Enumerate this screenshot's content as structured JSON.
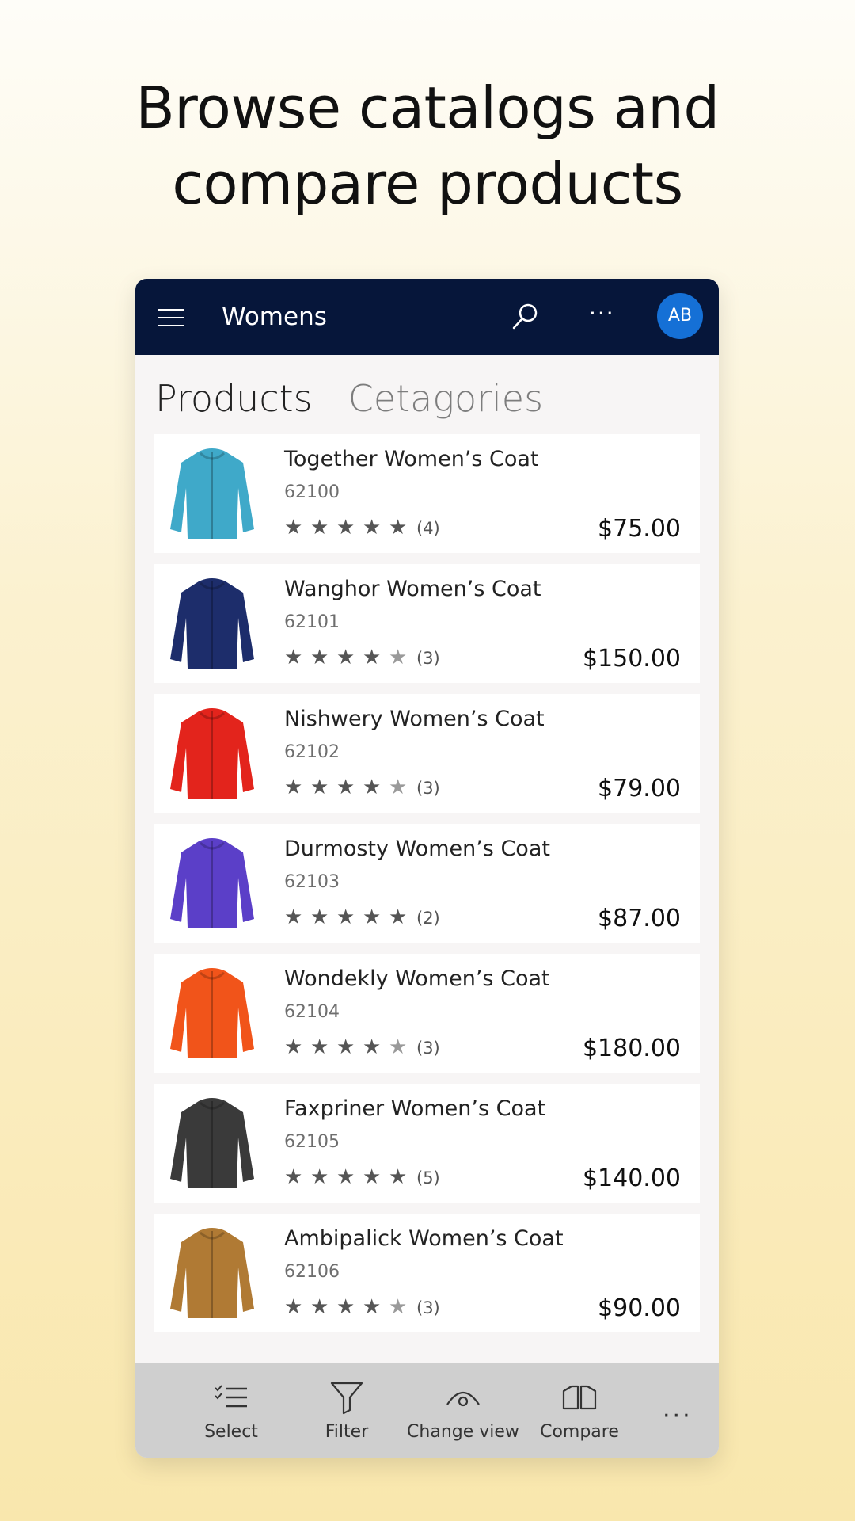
{
  "headline": {
    "line1": "Browse catalogs and",
    "line2": "compare products"
  },
  "appbar": {
    "title": "Womens",
    "avatar_initials": "AB"
  },
  "tabs": [
    {
      "label": "Products"
    },
    {
      "label": "Cetagories"
    }
  ],
  "products": [
    {
      "name": "Together Women’s Coat",
      "sku": "62100",
      "rating": 5,
      "reviews": "(4)",
      "price": "$75.00",
      "color": "#3fa9c9"
    },
    {
      "name": "Wanghor Women’s Coat",
      "sku": "62101",
      "rating": 4,
      "reviews": "(3)",
      "price": "$150.00",
      "color": "#1d2d6b"
    },
    {
      "name": "Nishwery Women’s Coat",
      "sku": "62102",
      "rating": 4,
      "reviews": "(3)",
      "price": "$79.00",
      "color": "#e3241c"
    },
    {
      "name": "Durmosty Women’s Coat",
      "sku": "62103",
      "rating": 5,
      "reviews": "(2)",
      "price": "$87.00",
      "color": "#5b3fc8"
    },
    {
      "name": "Wondekly Women’s Coat",
      "sku": "62104",
      "rating": 4,
      "reviews": "(3)",
      "price": "$180.00",
      "color": "#f1541a"
    },
    {
      "name": "Faxpriner Women’s Coat",
      "sku": "62105",
      "rating": 5,
      "reviews": "(5)",
      "price": "$140.00",
      "color": "#3a3a3a"
    },
    {
      "name": "Ambipalick Women’s Coat",
      "sku": "62106",
      "rating": 4,
      "reviews": "(3)",
      "price": "$90.00",
      "color": "#b07a34"
    }
  ],
  "commands": [
    {
      "label": "Select",
      "icon": "select-list-icon"
    },
    {
      "label": "Filter",
      "icon": "filter-icon"
    },
    {
      "label": "Change view",
      "icon": "eye-icon"
    },
    {
      "label": "Compare",
      "icon": "compare-icon"
    }
  ],
  "colors": {
    "appbar": "#06163a",
    "avatar": "#1570d6",
    "command_bar": "#cfcfcf"
  }
}
